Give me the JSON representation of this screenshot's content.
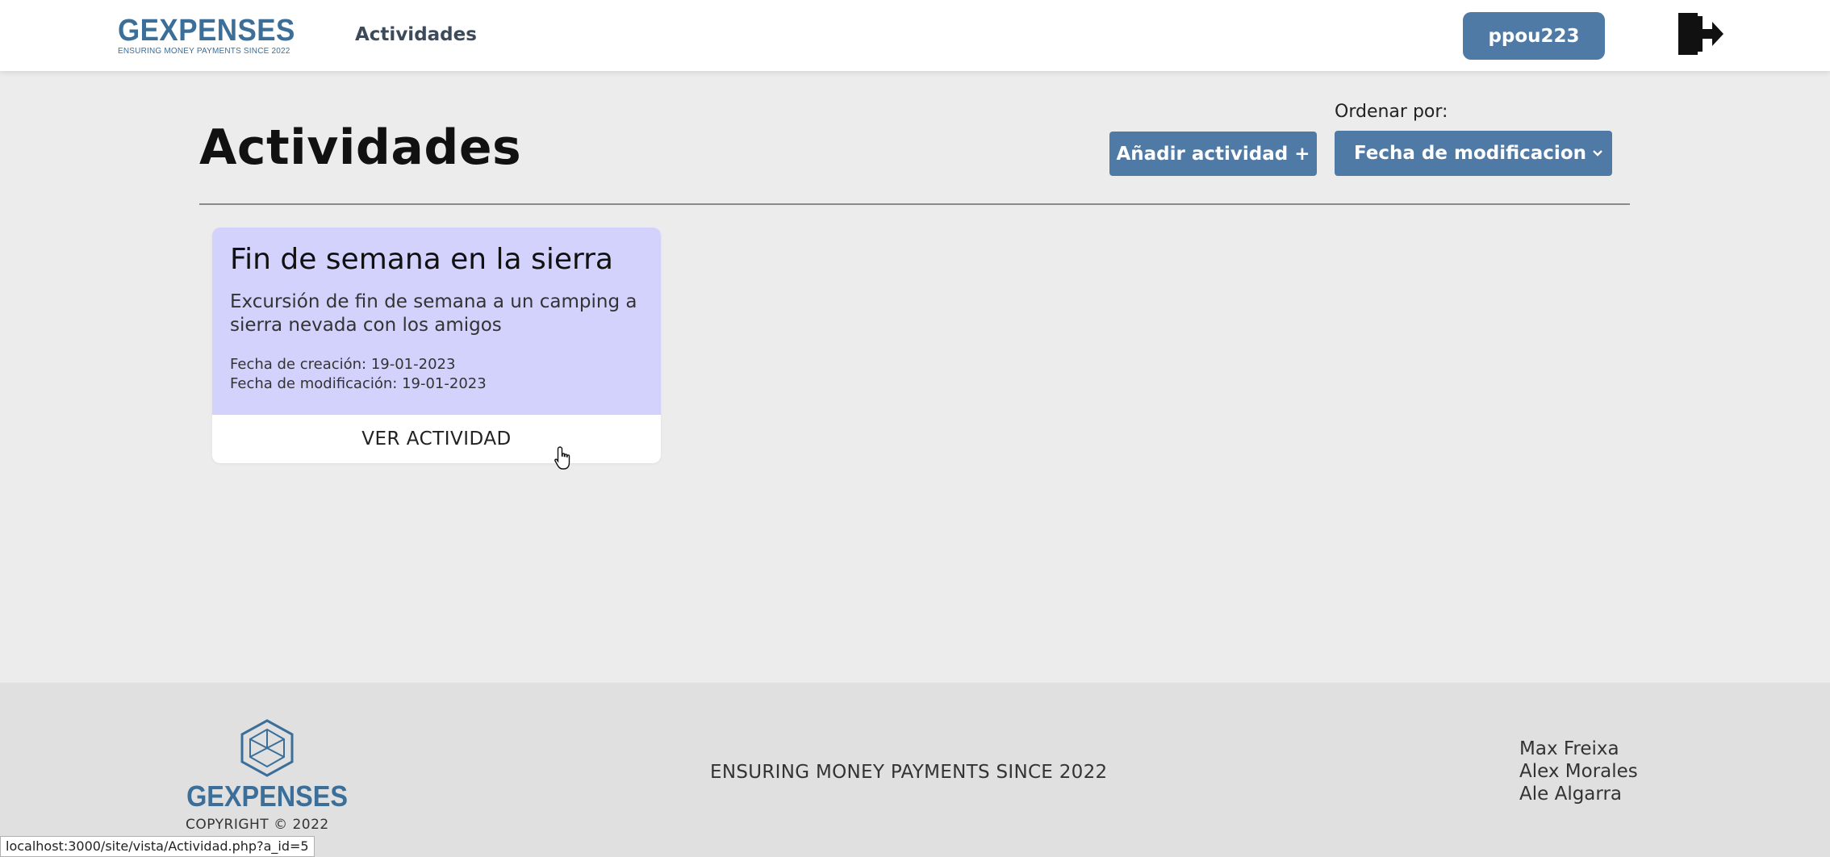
{
  "header": {
    "brand_name": "GEXPENSES",
    "brand_tagline": "ENSURING MONEY PAYMENTS SINCE 2022",
    "nav_link": "Actividades",
    "user_button": "ppou223",
    "logout_icon": "logout-door-icon"
  },
  "main": {
    "title": "Actividades",
    "add_button": "Añadir actividad +",
    "sort_label": "Ordenar por:",
    "sort_selected": "Fecha de modificacion",
    "cards": [
      {
        "title": "Fin de semana en la sierra",
        "description": "Excursión de fin de semana a un camping a sierra nevada con los amigos",
        "created": "Fecha de creación: 19-01-2023",
        "modified": "Fecha de modificación: 19-01-2023",
        "action": "VER ACTIVIDAD",
        "color": "#d3d2fc"
      }
    ]
  },
  "footer": {
    "brand_name": "GEXPENSES",
    "copyright": "COPYRIGHT © 2022",
    "tagline": "ENSURING MONEY PAYMENTS SINCE 2022",
    "authors": [
      "Max Freixa",
      "Alex Morales",
      "Ale Algarra"
    ]
  },
  "status_bar": {
    "url": "localhost:3000/site/vista/Actividad.php?a_id=5"
  },
  "colors": {
    "accent": "#4f7aa6",
    "brand": "#3b6f99",
    "card": "#d3d2fc",
    "background": "#ececec",
    "footer": "#e0e0e0"
  }
}
